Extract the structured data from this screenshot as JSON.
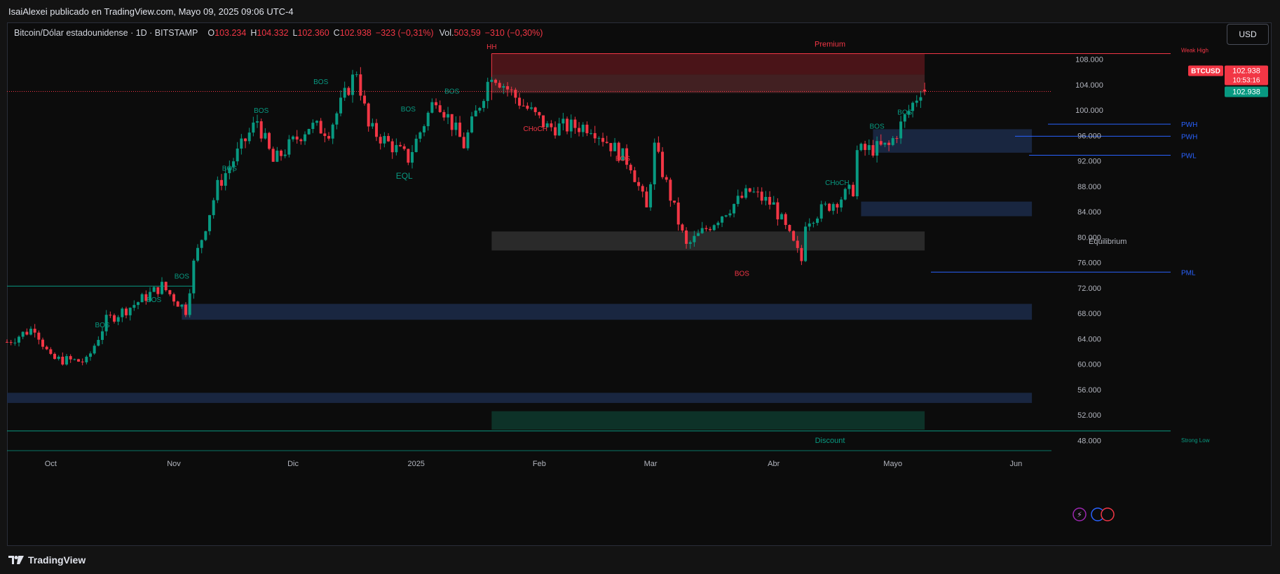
{
  "publication": {
    "text": "IsaiAlexei publicado en TradingView.com, Mayo 09, 2025 09:06 UTC-4"
  },
  "legend": {
    "symbol": "Bitcoin/Dólar estadounidense · 1D · BITSTAMP",
    "o_label": "O",
    "o_value": "103.234",
    "h_label": "H",
    "h_value": "104.332",
    "l_label": "L",
    "l_value": "102.360",
    "c_label": "C",
    "c_value": "102.938",
    "change": "−323 (−0,31%)",
    "vol_label": "Vol.",
    "vol_value": "503,59",
    "vol_change": "−310 (−0,30%)"
  },
  "currency_button": "USD",
  "footer": {
    "brand": "TradingView"
  },
  "colors": {
    "up": "#089981",
    "down": "#f23645",
    "blue_zone": "#1c2b4a",
    "premium": "#f23645",
    "discount": "#0d3b2e"
  },
  "chart_data": {
    "type": "candlestick",
    "price_axis": {
      "ticks": [
        "108.000",
        "104.000",
        "100.000",
        "96.000",
        "92.000",
        "88.000",
        "84.000",
        "80.000",
        "76.000",
        "72.000",
        "68.000",
        "64.000",
        "60.000",
        "56.000",
        "52.000",
        "48.000"
      ],
      "range": [
        46500,
        110500
      ]
    },
    "time_axis": {
      "labels": [
        {
          "text": "Oct",
          "date": "2024-10-01"
        },
        {
          "text": "Nov",
          "date": "2024-11-01"
        },
        {
          "text": "Dic",
          "date": "2024-12-01"
        },
        {
          "text": "2025",
          "date": "2025-01-01"
        },
        {
          "text": "Feb",
          "date": "2025-02-01"
        },
        {
          "text": "Mar",
          "date": "2025-03-01"
        },
        {
          "text": "Abr",
          "date": "2025-04-01"
        },
        {
          "text": "Mayo",
          "date": "2025-05-01"
        },
        {
          "text": "Jun",
          "date": "2025-06-01"
        }
      ]
    },
    "price_badges": {
      "symbol": "BTCUSD",
      "last": "102.938",
      "countdown": "10:53:16",
      "close": "102.938"
    },
    "series": [
      {
        "date": "2024-09-20",
        "close": 63500
      },
      {
        "date": "2024-09-27",
        "close": 65800
      },
      {
        "date": "2024-10-01",
        "close": 60800
      },
      {
        "date": "2024-10-10",
        "close": 60400
      },
      {
        "date": "2024-10-15",
        "close": 66900
      },
      {
        "date": "2024-10-21",
        "close": 69000
      },
      {
        "date": "2024-10-29",
        "close": 72300
      },
      {
        "date": "2024-11-04",
        "close": 68500
      },
      {
        "date": "2024-11-06",
        "close": 75800
      },
      {
        "date": "2024-11-12",
        "close": 88000
      },
      {
        "date": "2024-11-22",
        "close": 98400
      },
      {
        "date": "2024-11-26",
        "close": 91800
      },
      {
        "date": "2024-12-05",
        "close": 97500
      },
      {
        "date": "2024-12-10",
        "close": 96800
      },
      {
        "date": "2024-12-17",
        "close": 106300
      },
      {
        "date": "2024-12-20",
        "close": 97200
      },
      {
        "date": "2024-12-30",
        "close": 92400
      },
      {
        "date": "2025-01-06",
        "close": 102200
      },
      {
        "date": "2025-01-13",
        "close": 94500
      },
      {
        "date": "2025-01-20",
        "close": 106000
      },
      {
        "date": "2025-01-27",
        "close": 101400
      },
      {
        "date": "2025-02-03",
        "close": 97300
      },
      {
        "date": "2025-02-14",
        "close": 97500
      },
      {
        "date": "2025-02-24",
        "close": 91500
      },
      {
        "date": "2025-02-28",
        "close": 84300
      },
      {
        "date": "2025-03-02",
        "close": 94200
      },
      {
        "date": "2025-03-10",
        "close": 78500
      },
      {
        "date": "2025-03-20",
        "close": 84200
      },
      {
        "date": "2025-03-26",
        "close": 87200
      },
      {
        "date": "2025-04-01",
        "close": 85000
      },
      {
        "date": "2025-04-08",
        "close": 76300
      },
      {
        "date": "2025-04-09",
        "close": 82600
      },
      {
        "date": "2025-04-21",
        "close": 87500
      },
      {
        "date": "2025-04-22",
        "close": 93500
      },
      {
        "date": "2025-04-30",
        "close": 94300
      },
      {
        "date": "2025-05-08",
        "close": 103200
      },
      {
        "date": "2025-05-09",
        "open": 103234,
        "high": 104332,
        "low": 102360,
        "close": 102938
      }
    ],
    "zones": [
      {
        "label": "Premium",
        "from": "2025-01-20",
        "to": "2025-05-09",
        "low": 105600,
        "high": 108900
      },
      {
        "label": "",
        "from": "2025-01-20",
        "to": "2025-05-09",
        "low": 102700,
        "high": 105600
      },
      {
        "label": "Equilibrium",
        "from": "2025-01-20",
        "to": "2025-05-09",
        "low": 77900,
        "high": 80900
      },
      {
        "label": "Discount",
        "from": "2025-01-20",
        "to": "2025-05-09",
        "low": 49700,
        "high": 52600
      },
      {
        "label": "",
        "from": "2024-11-03",
        "to": "2025-06-05",
        "low": 67000,
        "high": 69500
      },
      {
        "label": "",
        "from": "2024-09-20",
        "to": "2025-06-05",
        "low": 53900,
        "high": 55500
      },
      {
        "label": "",
        "from": "2025-04-23",
        "to": "2025-06-05",
        "low": 83300,
        "high": 85600
      },
      {
        "label": "",
        "from": "2025-04-26",
        "to": "2025-06-05",
        "low": 93300,
        "high": 97000
      }
    ],
    "levels": [
      {
        "label": "Weak High",
        "price": 108900
      },
      {
        "label": "PWH",
        "price": 97800
      },
      {
        "label": "PWH",
        "price": 95900
      },
      {
        "label": "PWL",
        "price": 92900
      },
      {
        "label": "PML",
        "price": 74500
      },
      {
        "label": "Strong Low",
        "price": 49500
      }
    ],
    "annotations": [
      {
        "text": "HH",
        "date": "2025-01-20",
        "price": 109600
      },
      {
        "text": "BOS",
        "date": "2024-10-14",
        "price": 65800
      },
      {
        "text": "BOS",
        "date": "2024-10-27",
        "price": 69800
      },
      {
        "text": "BOS",
        "date": "2024-11-03",
        "price": 73500
      },
      {
        "text": "BOS",
        "date": "2024-11-15",
        "price": 90500
      },
      {
        "text": "BOS",
        "date": "2024-11-23",
        "price": 99600
      },
      {
        "text": "BOS",
        "date": "2024-12-08",
        "price": 104100
      },
      {
        "text": "BOS",
        "date": "2024-12-30",
        "price": 99800
      },
      {
        "text": "BOS",
        "date": "2025-01-10",
        "price": 102600
      },
      {
        "text": "EQL",
        "date": "2024-12-29",
        "price": 89200
      },
      {
        "text": "CHoCH",
        "date": "2025-01-31",
        "price": 96700
      },
      {
        "text": "BOS",
        "date": "2025-02-22",
        "price": 92000
      },
      {
        "text": "BOS",
        "date": "2025-03-24",
        "price": 73900
      },
      {
        "text": "CHoCH",
        "date": "2025-04-17",
        "price": 88200
      },
      {
        "text": "BOS",
        "date": "2025-04-27",
        "price": 97100
      },
      {
        "text": "BOS",
        "date": "2025-05-04",
        "price": 99300
      }
    ]
  }
}
